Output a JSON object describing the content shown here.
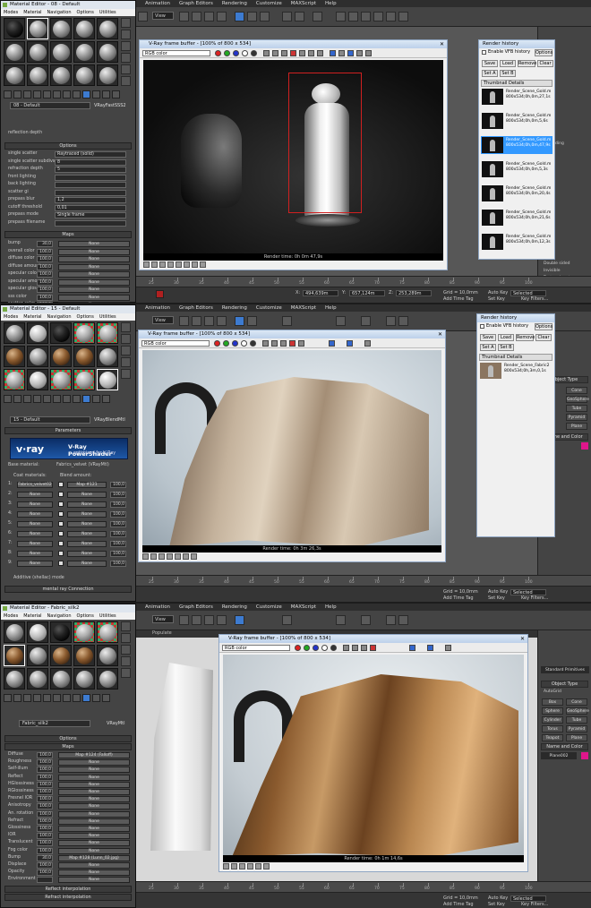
{
  "menu": [
    "Animation",
    "Graph Editors",
    "Rendering",
    "Customize",
    "MAXScript",
    "Help"
  ],
  "view_label": "View",
  "ribbon_label": "Populate",
  "time_ticks": [
    "25",
    "30",
    "35",
    "40",
    "45",
    "50",
    "55",
    "60",
    "65",
    "70",
    "75",
    "80",
    "85",
    "90",
    "95",
    "100"
  ],
  "status": {
    "x": "494,639m",
    "y": "657,124m",
    "z": "253,289m",
    "grid": "Grid = 10,0mm",
    "autokey": "Auto Key",
    "selected": "Selected",
    "setkey": "Set Key",
    "keyfilters": "Key Filters...",
    "addtimetag": "Add Time Tag"
  },
  "panel1": {
    "me_title": "Material Editor - 08 - Default",
    "me_menu": [
      "Modes",
      "Material",
      "Navigation",
      "Options",
      "Utilities"
    ],
    "mat_name": "08 - Default",
    "mat_type": "VRayFastSSS2",
    "reflection_depth": "reflection depth",
    "options_header": "Options",
    "options": [
      {
        "label": "single scatter",
        "value": "Raytraced (solid)"
      },
      {
        "label": "single scatter subdivs",
        "value": "8"
      },
      {
        "label": "refraction depth",
        "value": "5"
      },
      {
        "label": "front lighting",
        "value": ""
      },
      {
        "label": "back lighting",
        "value": ""
      },
      {
        "label": "scatter gi",
        "value": ""
      },
      {
        "label": "prepass blur",
        "value": "1,2"
      },
      {
        "label": "cutoff threshold",
        "value": "0,01"
      },
      {
        "label": "prepass mode",
        "value": "Single frame"
      },
      {
        "label": "prepass filename",
        "value": ""
      }
    ],
    "maps_header": "Maps",
    "maps": [
      {
        "label": "bump",
        "amount": "30,0",
        "map": "None"
      },
      {
        "label": "overall color",
        "amount": "100,0",
        "map": "None"
      },
      {
        "label": "diffuse color",
        "amount": "100,0",
        "map": "None"
      },
      {
        "label": "diffuse amount",
        "amount": "100,0",
        "map": "None"
      },
      {
        "label": "specular color",
        "amount": "100,0",
        "map": "None"
      },
      {
        "label": "specular amount",
        "amount": "100,0",
        "map": "None"
      },
      {
        "label": "specular glossiness",
        "amount": "100,0",
        "map": "None"
      },
      {
        "label": "sss color",
        "amount": "100,0",
        "map": "None"
      },
      {
        "label": "scatter color",
        "amount": "100,0",
        "map": "None"
      }
    ],
    "vfb_title": "V-Ray frame buffer - [100% of 800 x 534]",
    "channel": "RGB color",
    "render_time": "Render time: 0h 0m 47,9s",
    "history": {
      "title": "Render history",
      "enable": "Enable VFB history",
      "options": "Options",
      "buttons": [
        "Save",
        "Load",
        "Remove",
        "Clear",
        "Set A",
        "Set B"
      ],
      "cols": [
        "Thumbnail",
        "Details"
      ],
      "items": [
        {
          "name": "Render_Scene_Gold.m",
          "info": "800x534;0h,0m,27,1s"
        },
        {
          "name": "Render_Scene_Gold.m",
          "info": "800x534;0h,0m,5,6s"
        },
        {
          "name": "Render_Scene_Gold.m",
          "info": "800x534;0h,0m,47,9s",
          "selected": true
        },
        {
          "name": "Render_Scene_Gold.m",
          "info": "800x534;0h,0m,5,3s"
        },
        {
          "name": "Render_Scene_Gold.m",
          "info": "800x534;0h,0m,20,4s"
        },
        {
          "name": "Render_Scene_Gold.m",
          "info": "800x534;0h,0m,21,6s"
        },
        {
          "name": "Render_Scene_Gold.m",
          "info": "800x534;0h,0m,12,3s"
        }
      ]
    },
    "cmd": {
      "labels": [
        "rt shading",
        "Double sided",
        "Invisible",
        "Texture Input sensor"
      ]
    }
  },
  "panel2": {
    "me_title": "Material Editor - 15 - Default",
    "me_menu": [
      "Modes",
      "Material",
      "Navigation",
      "Options",
      "Utilities"
    ],
    "mat_name": "15 - Default",
    "mat_type": "VRayBlendMtl",
    "params_header": "Parameters",
    "vray_logo": "v·ray",
    "vray_title": "V-Ray PowerShader",
    "vray_sub": "optimized for V-Ray",
    "base_label": "Base material:",
    "base_value": "Fabrics_velvet (VRayMtl)",
    "coat_label": "Coat materials:",
    "blend_label": "Blend amount:",
    "coats": [
      {
        "n": "1:",
        "mat": "Fabrics_velvet02",
        "blend": "Map #121",
        "amt": "100,0"
      },
      {
        "n": "2:",
        "mat": "None",
        "blend": "None",
        "amt": "100,0"
      },
      {
        "n": "3:",
        "mat": "None",
        "blend": "None",
        "amt": "100,0"
      },
      {
        "n": "4:",
        "mat": "None",
        "blend": "None",
        "amt": "100,0"
      },
      {
        "n": "5:",
        "mat": "None",
        "blend": "None",
        "amt": "100,0"
      },
      {
        "n": "6:",
        "mat": "None",
        "blend": "None",
        "amt": "100,0"
      },
      {
        "n": "7:",
        "mat": "None",
        "blend": "None",
        "amt": "100,0"
      },
      {
        "n": "8:",
        "mat": "None",
        "blend": "None",
        "amt": "100,0"
      },
      {
        "n": "9:",
        "mat": "None",
        "blend": "None",
        "amt": "100,0"
      }
    ],
    "additive": "Additive (shellac) mode",
    "mr_conn": "mental ray Connection",
    "vfb_title": "V-Ray frame buffer - [100% of 800 x 534]",
    "channel": "RGB color",
    "render_time": "Render time: 0h 3m 26,3s",
    "history": {
      "title": "Render history",
      "enable": "Enable VFB history",
      "options": "Options",
      "buttons": [
        "Save",
        "Load",
        "Remove",
        "Clear",
        "Set A",
        "Set B"
      ],
      "cols": [
        "Thumbnail",
        "Details"
      ],
      "items": [
        {
          "name": "Render_Scene_Fabric2",
          "info": "800x534;0h,3m,0,1s"
        }
      ]
    },
    "cmd": {
      "header": "Object Type",
      "buttons": [
        "Cone",
        "GeoSphere",
        "Tube",
        "Pyramid",
        "Plane"
      ],
      "color": "Name and Color"
    }
  },
  "panel3": {
    "me_title": "Material Editor - Fabric_silk2",
    "me_menu": [
      "Modes",
      "Material",
      "Navigation",
      "Options",
      "Utilities"
    ],
    "mat_name": "Fabric_silk2",
    "mat_type": "VRayMtl",
    "options_header": "Options",
    "maps_header": "Maps",
    "maps": [
      {
        "label": "Diffuse",
        "amount": "100,0",
        "map": "Map #124 (Falloff)"
      },
      {
        "label": "Roughness",
        "amount": "100,0",
        "map": "None"
      },
      {
        "label": "Self-illum",
        "amount": "100,0",
        "map": "None"
      },
      {
        "label": "Reflect",
        "amount": "100,0",
        "map": "None"
      },
      {
        "label": "HGlossiness",
        "amount": "100,0",
        "map": "None"
      },
      {
        "label": "RGlossiness",
        "amount": "100,0",
        "map": "None"
      },
      {
        "label": "Fresnel IOR",
        "amount": "100,0",
        "map": "None"
      },
      {
        "label": "Anisotropy",
        "amount": "100,0",
        "map": "None"
      },
      {
        "label": "An. rotation",
        "amount": "100,0",
        "map": "None"
      },
      {
        "label": "Refract",
        "amount": "100,0",
        "map": "None"
      },
      {
        "label": "Glossiness",
        "amount": "100,0",
        "map": "None"
      },
      {
        "label": "IOR",
        "amount": "100,0",
        "map": "None"
      },
      {
        "label": "Translucent",
        "amount": "100,0",
        "map": "None"
      },
      {
        "label": "Fog color",
        "amount": "100,0",
        "map": "None"
      },
      {
        "label": "Bump",
        "amount": "30,0",
        "map": "Map #128 (Lunn_02.jpg)"
      },
      {
        "label": "Displace",
        "amount": "100,0",
        "map": "None"
      },
      {
        "label": "Opacity",
        "amount": "100,0",
        "map": "None"
      },
      {
        "label": "Environment",
        "amount": "",
        "map": "None"
      }
    ],
    "reflect_interp": "Reflect interpolation",
    "refract_interp": "Refract interpolation",
    "vfb_title": "V-Ray frame buffer - [100% of 800 x 534]",
    "channel": "RGB color",
    "render_time": "Render time: 0h 1m 14,6s",
    "cmd": {
      "dropdown": "Standard Primitives",
      "header": "Object Type",
      "autogrid": "AutoGrid",
      "buttons": [
        "Box",
        "Cone",
        "Sphere",
        "GeoSphere",
        "Cylinder",
        "Tube",
        "Torus",
        "Pyramid",
        "Teapot",
        "Plane"
      ],
      "color": "Name and Color",
      "objname": "Plane002"
    }
  },
  "colors": {
    "accent": "#3399ff",
    "max_bg": "#444444",
    "vray_blue": "#1e58a8",
    "silk": "#8a5a2e",
    "velvet": "#b7a48e"
  }
}
